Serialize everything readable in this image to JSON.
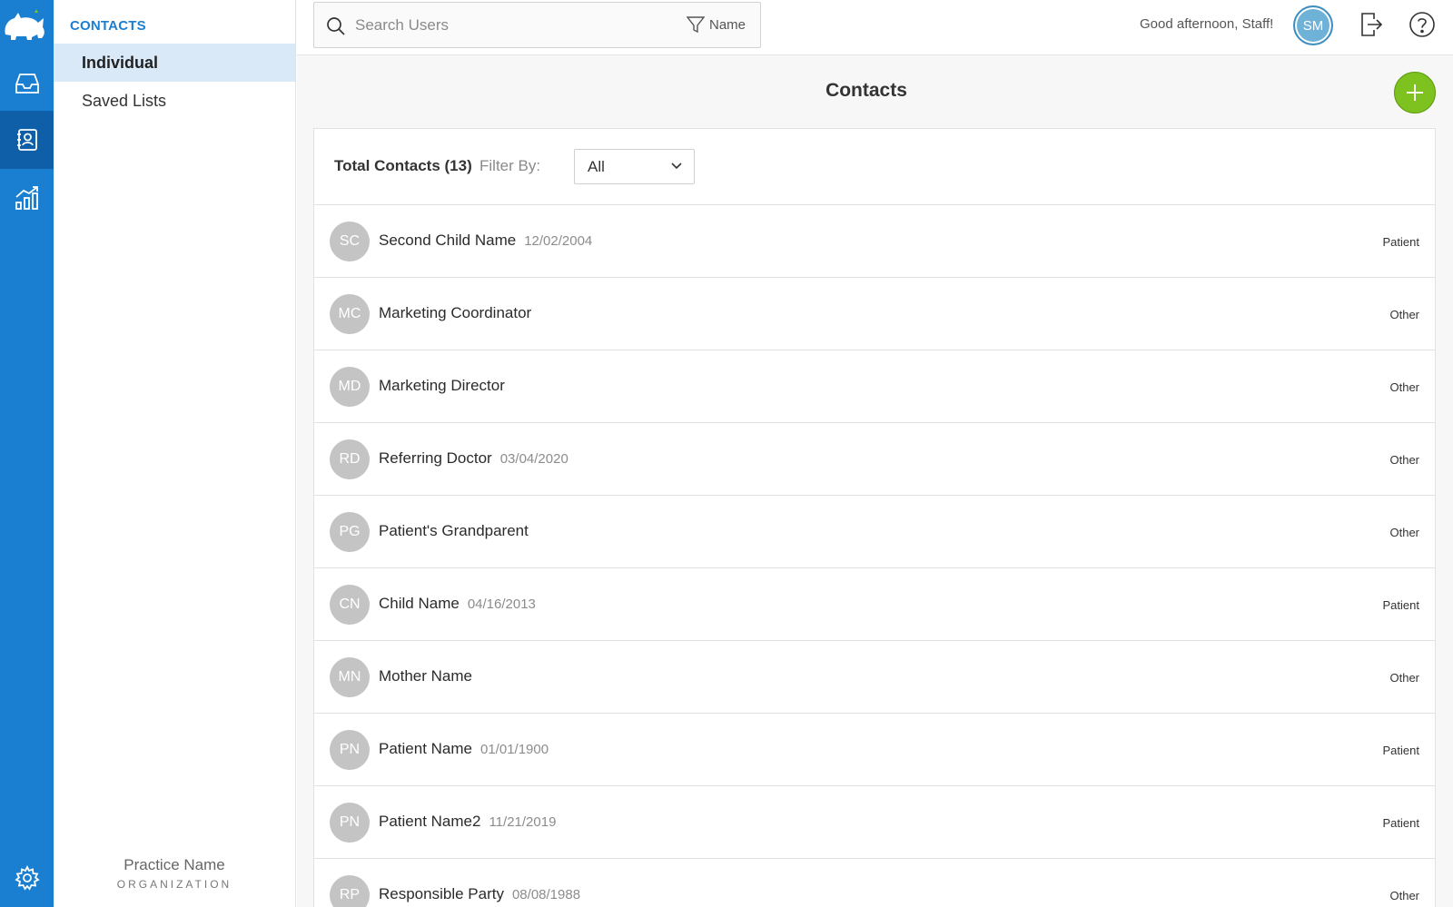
{
  "rail": {
    "logo_text": "rhinogram",
    "items": [
      {
        "name": "inbox-icon"
      },
      {
        "name": "contacts-icon"
      },
      {
        "name": "analytics-icon"
      },
      {
        "name": "settings-icon"
      }
    ],
    "brand_color": "#1a7fd1",
    "active_color": "#0f5fa8"
  },
  "subnav": {
    "title": "CONTACTS",
    "items": [
      {
        "label": "Individual",
        "active": true
      },
      {
        "label": "Saved Lists",
        "active": false
      }
    ],
    "practice_name": "Practice Name",
    "practice_org": "ORGANIZATION"
  },
  "topbar": {
    "search_placeholder": "Search Users",
    "search_value": "",
    "filter_label": "Name",
    "greeting": "Good afternoon, Staff!",
    "avatar_initials": "SM"
  },
  "main": {
    "title": "Contacts",
    "total_label": "Total Contacts (13)",
    "filter_by_label": "Filter By:",
    "filter_value": "All",
    "add_button_color": "#7dc21e"
  },
  "contacts": [
    {
      "initials": "SC",
      "name": "Second Child Name",
      "dob": "12/02/2004",
      "type": "Patient"
    },
    {
      "initials": "MC",
      "name": "Marketing Coordinator",
      "dob": "",
      "type": "Other"
    },
    {
      "initials": "MD",
      "name": "Marketing Director",
      "dob": "",
      "type": "Other"
    },
    {
      "initials": "RD",
      "name": "Referring Doctor",
      "dob": "03/04/2020",
      "type": "Other"
    },
    {
      "initials": "PG",
      "name": "Patient's Grandparent",
      "dob": "",
      "type": "Other"
    },
    {
      "initials": "CN",
      "name": "Child Name",
      "dob": "04/16/2013",
      "type": "Patient"
    },
    {
      "initials": "MN",
      "name": "Mother Name",
      "dob": "",
      "type": "Other"
    },
    {
      "initials": "PN",
      "name": "Patient Name",
      "dob": "01/01/1900",
      "type": "Patient"
    },
    {
      "initials": "PN",
      "name": "Patient Name2",
      "dob": "11/21/2019",
      "type": "Patient"
    },
    {
      "initials": "RP",
      "name": "Responsible Party",
      "dob": "08/08/1988",
      "type": "Other"
    }
  ]
}
